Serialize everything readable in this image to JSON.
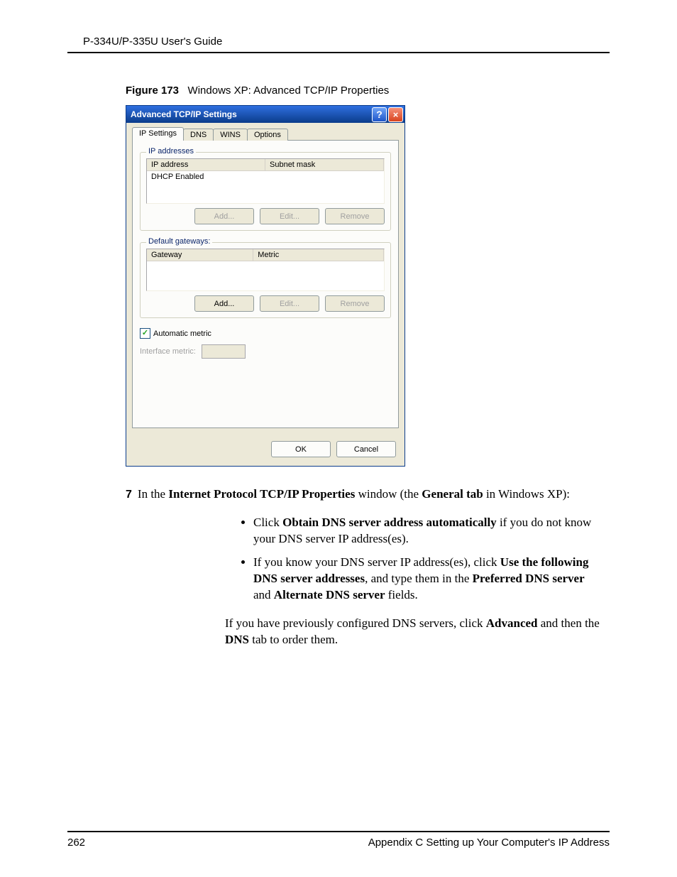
{
  "page": {
    "header": "P-334U/P-335U User's Guide",
    "footer_left": "262",
    "footer_right": "Appendix C Setting up Your Computer's IP Address"
  },
  "figure": {
    "label": "Figure 173",
    "caption": "Windows XP: Advanced TCP/IP Properties"
  },
  "dialog": {
    "title": "Advanced TCP/IP Settings",
    "tabs": [
      "IP Settings",
      "DNS",
      "WINS",
      "Options"
    ],
    "ip_group": {
      "legend": "IP addresses",
      "col1": "IP address",
      "col2": "Subnet mask",
      "row1": "DHCP Enabled",
      "btn_add": "Add...",
      "btn_edit": "Edit...",
      "btn_remove": "Remove"
    },
    "gw_group": {
      "legend": "Default gateways:",
      "col1": "Gateway",
      "col2": "Metric",
      "btn_add": "Add...",
      "btn_edit": "Edit...",
      "btn_remove": "Remove"
    },
    "auto_metric": "Automatic metric",
    "iface_metric": "Interface metric:",
    "ok": "OK",
    "cancel": "Cancel"
  },
  "step": {
    "num": "7",
    "t1": "In the ",
    "b1": "Internet Protocol TCP/IP Properties",
    "t2": " window (the ",
    "b2": "General tab",
    "t3": " in Windows XP):"
  },
  "bullets": {
    "a_t1": "Click ",
    "a_b1": "Obtain DNS server address automatically",
    "a_t2": " if you do not know your DNS server IP address(es).",
    "b_t1": "If you know your DNS server IP address(es), click ",
    "b_b1": "Use the following DNS server addresses",
    "b_t2": ", and type them in the ",
    "b_b2": "Preferred DNS server",
    "b_t3": " and ",
    "b_b3": "Alternate DNS server",
    "b_t4": " fields."
  },
  "para": {
    "t1": "If you have previously configured DNS servers, click ",
    "b1": "Advanced",
    "t2": " and then the ",
    "b2": "DNS",
    "t3": " tab to order them."
  }
}
